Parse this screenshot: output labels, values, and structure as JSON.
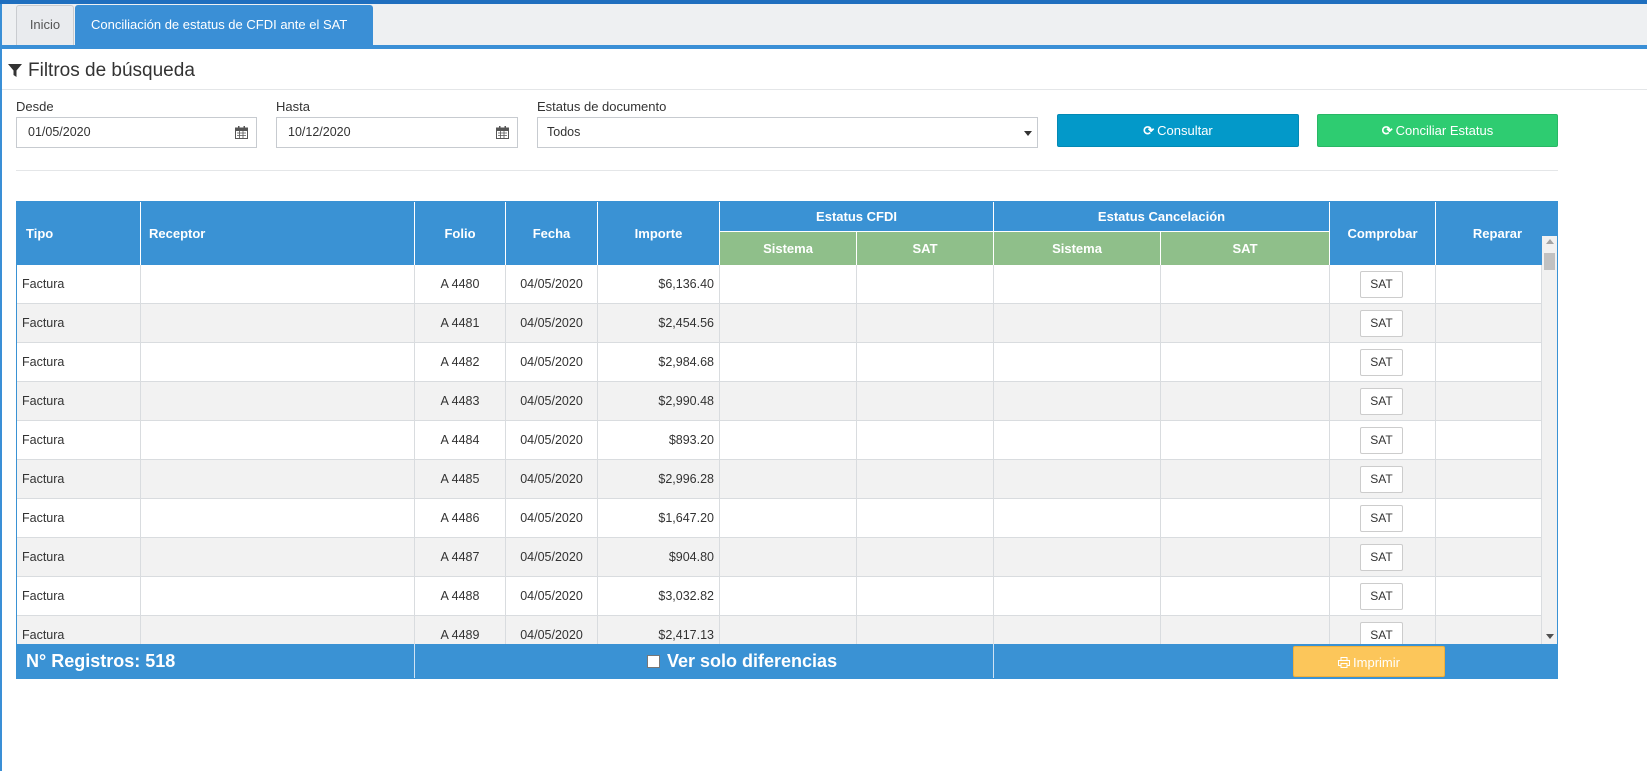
{
  "tabs": {
    "home": "Inicio",
    "active": "Conciliación de estatus de CFDI ante el SAT"
  },
  "filters": {
    "title": "Filtros de búsqueda",
    "desde_label": "Desde",
    "desde_value": "01/05/2020",
    "hasta_label": "Hasta",
    "hasta_value": "10/12/2020",
    "estatus_label": "Estatus de documento",
    "estatus_value": "Todos",
    "consultar_label": "Consultar",
    "conciliar_label": "Conciliar Estatus"
  },
  "table": {
    "headers": {
      "tipo": "Tipo",
      "receptor": "Receptor",
      "folio": "Folio",
      "fecha": "Fecha",
      "importe": "Importe",
      "estatus_cfdi": "Estatus CFDI",
      "estatus_cancelacion": "Estatus Cancelación",
      "sistema": "Sistema",
      "sat": "SAT",
      "comprobar": "Comprobar",
      "reparar": "Reparar"
    },
    "sat_button_label": "SAT",
    "rows": [
      {
        "tipo": "Factura",
        "receptor": "",
        "folio": "A 4480",
        "fecha": "04/05/2020",
        "importe": "$6,136.40"
      },
      {
        "tipo": "Factura",
        "receptor": "",
        "folio": "A 4481",
        "fecha": "04/05/2020",
        "importe": "$2,454.56"
      },
      {
        "tipo": "Factura",
        "receptor": "",
        "folio": "A 4482",
        "fecha": "04/05/2020",
        "importe": "$2,984.68"
      },
      {
        "tipo": "Factura",
        "receptor": "",
        "folio": "A 4483",
        "fecha": "04/05/2020",
        "importe": "$2,990.48"
      },
      {
        "tipo": "Factura",
        "receptor": "",
        "folio": "A 4484",
        "fecha": "04/05/2020",
        "importe": "$893.20"
      },
      {
        "tipo": "Factura",
        "receptor": "",
        "folio": "A 4485",
        "fecha": "04/05/2020",
        "importe": "$2,996.28"
      },
      {
        "tipo": "Factura",
        "receptor": "",
        "folio": "A 4486",
        "fecha": "04/05/2020",
        "importe": "$1,647.20"
      },
      {
        "tipo": "Factura",
        "receptor": "",
        "folio": "A 4487",
        "fecha": "04/05/2020",
        "importe": "$904.80"
      },
      {
        "tipo": "Factura",
        "receptor": "",
        "folio": "A 4488",
        "fecha": "04/05/2020",
        "importe": "$3,032.82"
      },
      {
        "tipo": "Factura",
        "receptor": "",
        "folio": "A 4489",
        "fecha": "04/05/2020",
        "importe": "$2,417.13"
      }
    ]
  },
  "footer": {
    "records_label": "N° Registros: 518",
    "diff_label": "Ver solo diferencias",
    "print_label": "Imprimir"
  },
  "colors": {
    "primary_blue": "#3a92d4",
    "consultar_blue": "#0399c9",
    "conciliar_green": "#2ecc71",
    "subheader_green": "#8fbf8a",
    "print_yellow": "#fcc65a"
  }
}
